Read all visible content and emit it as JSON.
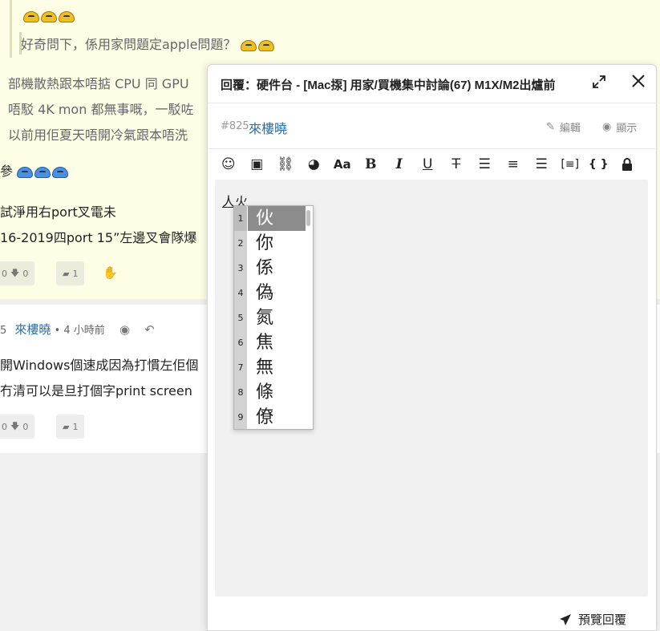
{
  "thread": {
    "post1": {
      "quote_reply": "好奇問下，係用家問題定apple問題？",
      "lines": [
        "部機散熱跟本唔掂 CPU 同 GPU",
        "唔駁 4K mon 都無事嘅，一駁咗",
        "以前用佢夏天唔開冷氣跟本唔洗"
      ],
      "line_tail": "參",
      "line2": "試淨用右port叉電未",
      "line3": "16-2019四port 15”左邊叉會隊爆",
      "up_count": "0",
      "down_count": "0",
      "reply_count": "1"
    },
    "post2": {
      "post_number_partial": "5",
      "author": "來樓曉",
      "time": "4 小時前",
      "line1": "開Windows個速成因為打慣左佢個",
      "line2": "冇清可以是旦打個字print screen",
      "up_count": "0",
      "down_count": "0",
      "reply_count": "1"
    }
  },
  "composer": {
    "title": "回覆：硬件台 - [Mac揼] 用家/買機集中討論(67) M1X/M2出爐前",
    "post_number": "#825",
    "reply_to": "來樓曉",
    "edit_label": "編輯",
    "show_label": "顯示",
    "typed_text": "人火",
    "preview_label": "預覽回覆"
  },
  "toolbar": [
    "smile-icon",
    "image-icon",
    "link-icon",
    "palette-icon",
    "font-size-icon",
    "bold-icon",
    "italic-icon",
    "underline-icon",
    "strikethrough-icon",
    "align-left-icon",
    "align-center-icon",
    "align-right-icon",
    "quote-block-icon",
    "code-icon",
    "lock-icon"
  ],
  "ime": {
    "candidates": [
      {
        "num": "1",
        "char": "伙"
      },
      {
        "num": "2",
        "char": "你"
      },
      {
        "num": "3",
        "char": "係"
      },
      {
        "num": "4",
        "char": "偽"
      },
      {
        "num": "5",
        "char": "氮"
      },
      {
        "num": "6",
        "char": "焦"
      },
      {
        "num": "7",
        "char": "無"
      },
      {
        "num": "8",
        "char": "條"
      },
      {
        "num": "9",
        "char": "僚"
      }
    ],
    "selected_index": 0
  },
  "colors": {
    "post_bg": "#fefee6",
    "link_blue": "#2a6fa8",
    "ime_highlight": "#8c8c8c"
  }
}
